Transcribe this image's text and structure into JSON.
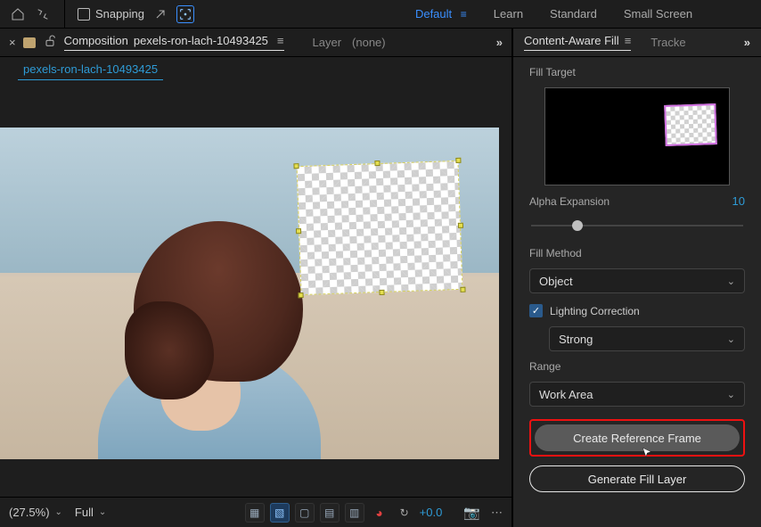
{
  "topbar": {
    "snapping_label": "Snapping"
  },
  "workspaces": {
    "default": "Default",
    "learn": "Learn",
    "standard": "Standard",
    "smallscreen": "Small Screen"
  },
  "comp_header": {
    "composition_word": "Composition",
    "composition_name": "pexels-ron-lach-10493425",
    "layer_label": "Layer",
    "layer_value": "(none)",
    "expand": "»"
  },
  "comp_tab": {
    "label": "pexels-ron-lach-10493425"
  },
  "footer": {
    "zoom": "(27.5%)",
    "resolution": "Full",
    "exposure": "+0.0"
  },
  "right": {
    "panel_title": "Content-Aware Fill",
    "other_tab": "Tracke",
    "expand": "»",
    "fill_target_label": "Fill Target",
    "alpha_expansion_label": "Alpha Expansion",
    "alpha_expansion_value": "10",
    "fill_method_label": "Fill Method",
    "fill_method_value": "Object",
    "lighting_correction_label": "Lighting Correction",
    "lighting_strength_value": "Strong",
    "range_label": "Range",
    "range_value": "Work Area",
    "create_reference_btn": "Create Reference Frame",
    "generate_fill_btn": "Generate Fill Layer"
  }
}
